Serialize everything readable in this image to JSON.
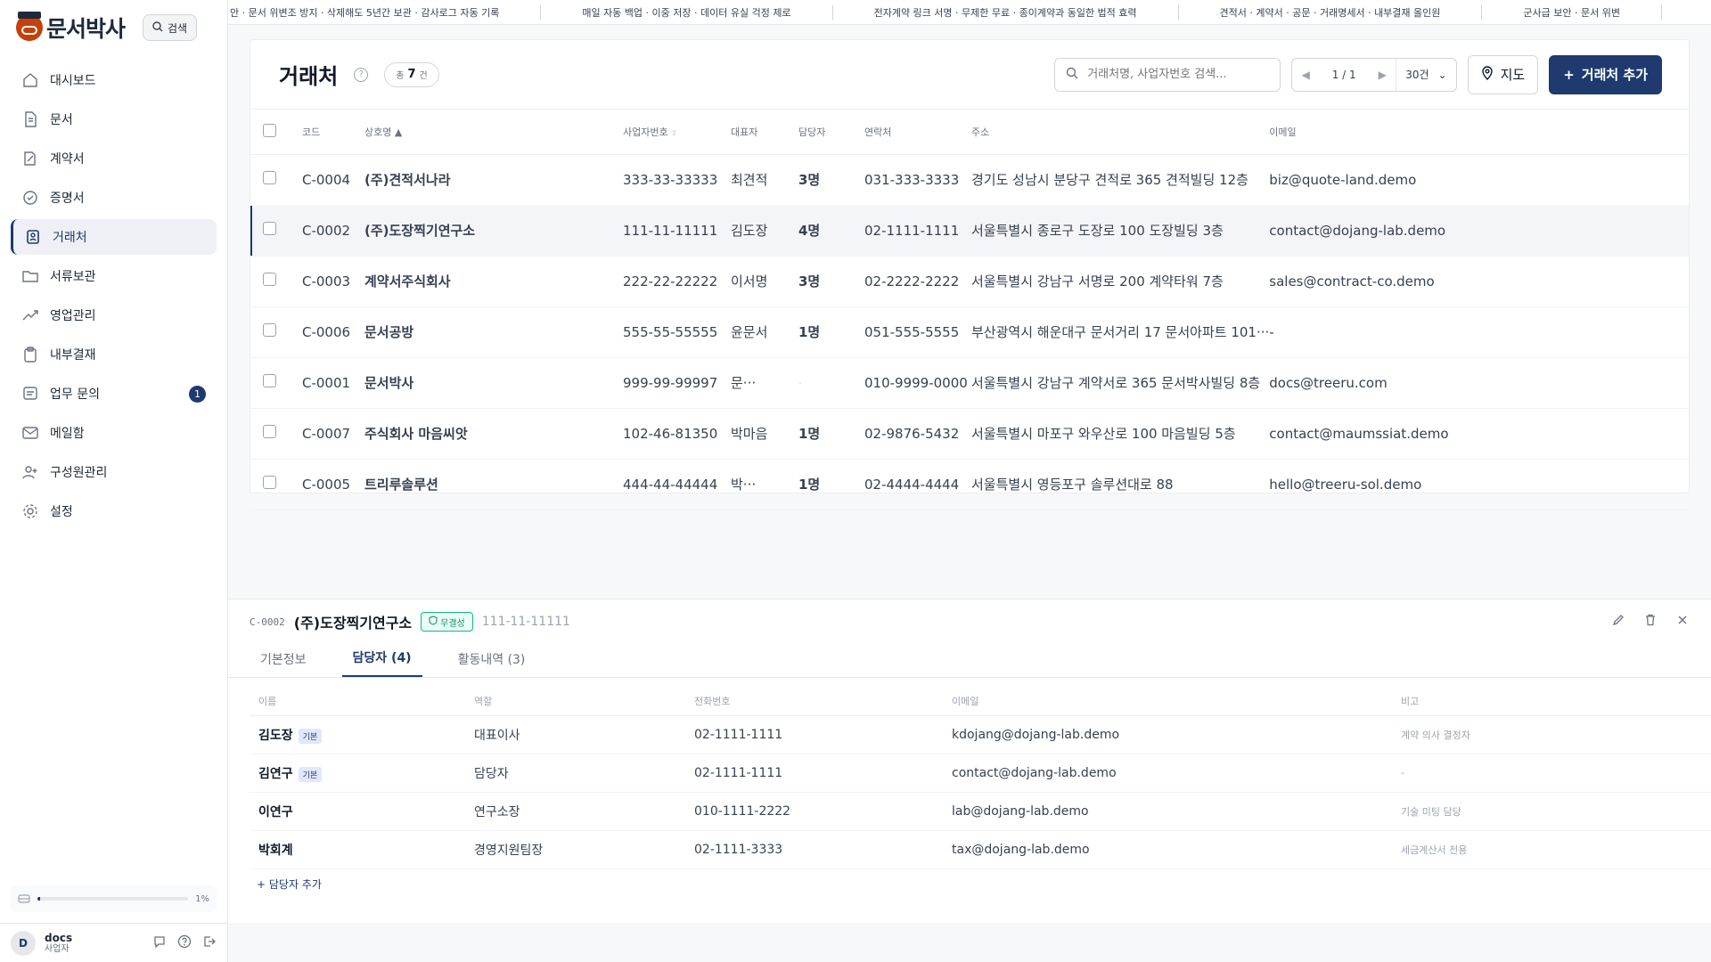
{
  "brand": {
    "name": "문서박사",
    "search_label": "검색"
  },
  "nav": [
    {
      "label": "대시보드",
      "icon": "home-icon"
    },
    {
      "label": "문서",
      "icon": "document-icon"
    },
    {
      "label": "계약서",
      "icon": "contract-icon"
    },
    {
      "label": "증명서",
      "icon": "certificate-icon"
    },
    {
      "label": "거래처",
      "icon": "partner-icon",
      "active": true
    },
    {
      "label": "서류보관",
      "icon": "folder-icon"
    },
    {
      "label": "영업관리",
      "icon": "trend-icon"
    },
    {
      "label": "내부결재",
      "icon": "clipboard-icon"
    },
    {
      "label": "업무 문의",
      "icon": "inquiry-icon",
      "badge": "1"
    },
    {
      "label": "메일함",
      "icon": "mail-icon"
    },
    {
      "label": "구성원관리",
      "icon": "add-user-icon"
    },
    {
      "label": "설정",
      "icon": "gear-icon"
    }
  ],
  "storage": {
    "percent": "1%",
    "fill": 0.01
  },
  "user": {
    "initial": "D",
    "name": "docs",
    "role": "사업자"
  },
  "ticker": [
    "안 · 문서 위변조 방지 · 삭제해도 5년간 보관 · 감사로그 자동 기록",
    "매일 자동 백업 · 이중 저장 · 데이터 유실 걱정 제로",
    "전자계약 링크 서명 · 무제한 무료 · 종이계약과 동일한 법적 효력",
    "견적서 · 계약서 · 공문 · 거래명세서 · 내부결재 올인원",
    "군사급 보안 · 문서 위변"
  ],
  "page": {
    "title": "거래처",
    "count_prefix": "총",
    "count": "7",
    "count_suffix": "건",
    "search_placeholder": "거래처명, 사업자번호 검색...",
    "pager": "1 / 1",
    "page_size": "30건",
    "map_label": "지도",
    "add_label": "거래처 추가"
  },
  "columns": {
    "code": "코드",
    "name": "상호명",
    "biz": "사업자번호",
    "ceo": "대표자",
    "staff": "담당자",
    "phone": "연락처",
    "addr": "주소",
    "email": "이메일"
  },
  "rows": [
    {
      "code": "C-0004",
      "name": "(주)견적서나라",
      "biz": "333-33-33333",
      "ceo": "최견적",
      "staff": "3명",
      "phone": "031-333-3333",
      "addr": "경기도 성남시 분당구 견적로 365 견적빌딩 12층",
      "email": "biz@quote-land.demo"
    },
    {
      "code": "C-0002",
      "name": "(주)도장찍기연구소",
      "biz": "111-11-11111",
      "ceo": "김도장",
      "staff": "4명",
      "phone": "02-1111-1111",
      "addr": "서울특별시 종로구 도장로 100 도장빌딩 3층",
      "email": "contact@dojang-lab.demo",
      "selected": true
    },
    {
      "code": "C-0003",
      "name": "계약서주식회사",
      "biz": "222-22-22222",
      "ceo": "이서명",
      "staff": "3명",
      "phone": "02-2222-2222",
      "addr": "서울특별시 강남구 서명로 200 계약타워 7층",
      "email": "sales@contract-co.demo"
    },
    {
      "code": "C-0006",
      "name": "문서공방",
      "biz": "555-55-55555",
      "ceo": "윤문서",
      "staff": "1명",
      "phone": "051-555-5555",
      "addr": "부산광역시 해운대구 문서거리 17 문서아파트 101···",
      "email": "-"
    },
    {
      "code": "C-0001",
      "name": "문서박사",
      "biz": "999-99-99997",
      "ceo": "문···",
      "staff": "-",
      "phone": "010-9999-0000",
      "addr": "서울특별시 강남구 계약서로 365 문서박사빌딩 8층",
      "email": "docs@treeru.com"
    },
    {
      "code": "C-0007",
      "name": "주식회사 마음씨앗",
      "biz": "102-46-81350",
      "ceo": "박마음",
      "staff": "1명",
      "phone": "02-9876-5432",
      "addr": "서울특별시 마포구 와우산로 100 마음빌딩 5층",
      "email": "contact@maumssiat.demo"
    },
    {
      "code": "C-0005",
      "name": "트리루솔루션",
      "biz": "444-44-44444",
      "ceo": "박···",
      "staff": "1명",
      "phone": "02-4444-4444",
      "addr": "서울특별시 영등포구 솔루션대로 88",
      "email": "hello@treeru-sol.demo"
    }
  ],
  "detail": {
    "code": "C-0002",
    "name": "(주)도장찍기연구소",
    "badge": "무결성",
    "biz": "111-11-11111",
    "tabs": [
      "기본정보",
      "담당자 (4)",
      "활동내역 (3)"
    ],
    "columns": {
      "name": "이름",
      "role": "역할",
      "phone": "전화번호",
      "email": "이메일",
      "note": "비고"
    },
    "contacts": [
      {
        "name": "김도장",
        "tag": "기본",
        "role": "대표이사",
        "phone": "02-1111-1111",
        "email": "kdojang@dojang-lab.demo",
        "note": "계약 의사 결정자"
      },
      {
        "name": "김연구",
        "tag": "기본",
        "role": "담당자",
        "phone": "02-1111-1111",
        "email": "contact@dojang-lab.demo",
        "note": "-"
      },
      {
        "name": "이연구",
        "tag": "",
        "role": "연구소장",
        "phone": "010-1111-2222",
        "email": "lab@dojang-lab.demo",
        "note": "기술 미팅 담당"
      },
      {
        "name": "박회계",
        "tag": "",
        "role": "경영지원팀장",
        "phone": "02-1111-3333",
        "email": "tax@dojang-lab.demo",
        "note": "세금계산서 전용"
      }
    ],
    "add_contact": "+ 담당자 추가"
  }
}
